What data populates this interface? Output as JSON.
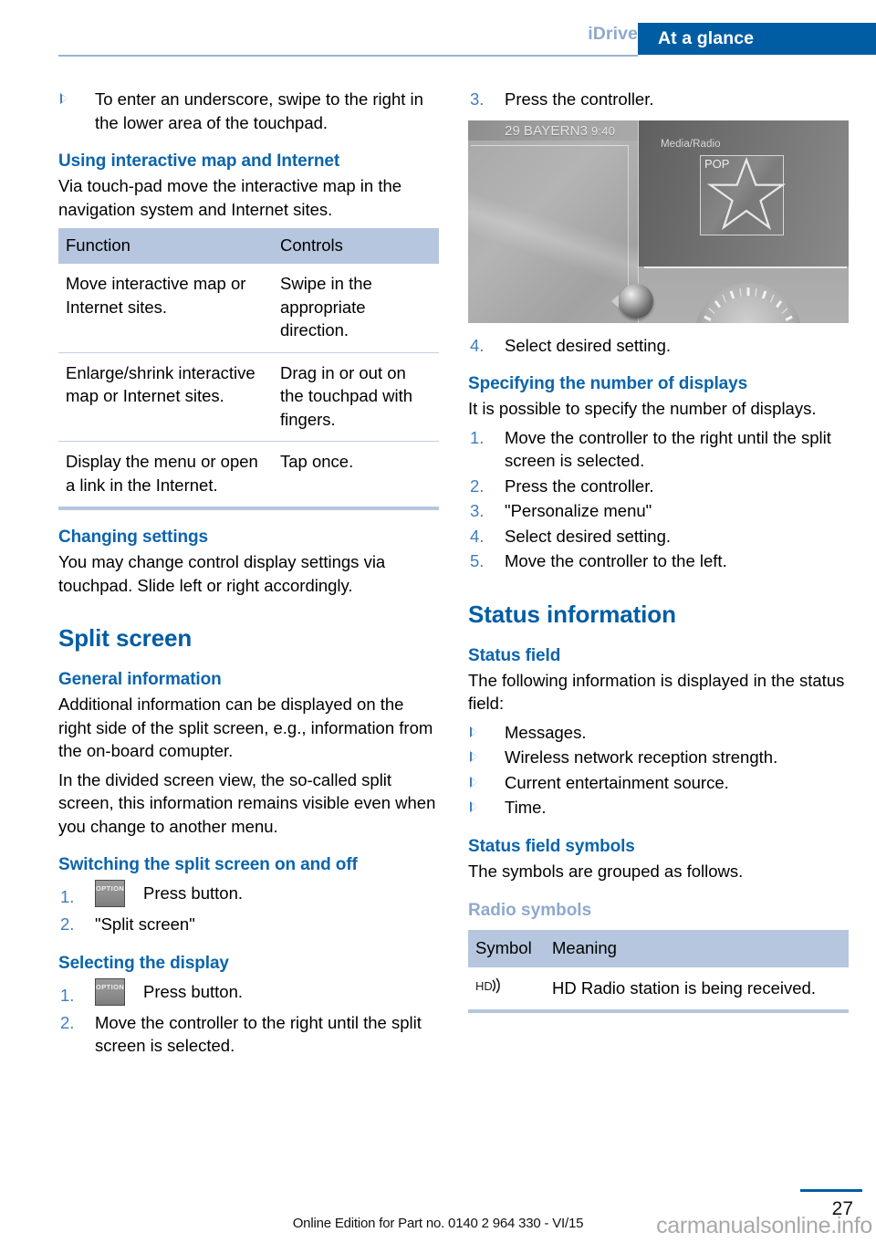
{
  "header": {
    "tab_secondary": "iDrive",
    "tab_active": "At a glance",
    "accent_blue": "#005da3",
    "muted_blue": "#8fa9cf"
  },
  "left_column": {
    "intro_bullet": "To enter an underscore, swipe to the right in the lower area of the touchpad.",
    "section_using_map": {
      "heading": "Using interactive map and Internet",
      "body": "Via touch-pad move the interactive map in the navigation system and Internet sites.",
      "table": {
        "columns": [
          "Function",
          "Controls"
        ],
        "rows": [
          [
            "Move interactive map or Internet sites.",
            "Swipe in the appropriate direction."
          ],
          [
            "Enlarge/shrink interactive map or Internet sites.",
            "Drag in or out on the touchpad with fingers."
          ],
          [
            "Display the menu or open a link in the Internet.",
            "Tap once."
          ]
        ]
      }
    },
    "section_changing_settings": {
      "heading": "Changing settings",
      "body": "You may change control display settings via touchpad. Slide left or right accordingly."
    },
    "section_split_screen": {
      "heading": "Split screen",
      "general": {
        "heading": "General information",
        "paragraph_1": "Additional information can be displayed on the right side of the split screen, e.g., information from the on-board comupter.",
        "paragraph_2": "In the divided screen view, the so-called split screen, this information remains visible even when you change to another menu."
      },
      "switching": {
        "heading": "Switching the split screen on and off",
        "steps": [
          {
            "num": "1.",
            "button": "OPTION",
            "text": "Press button."
          },
          {
            "num": "2.",
            "button": null,
            "text": "\"Split screen\""
          }
        ]
      },
      "selecting": {
        "heading": "Selecting the display",
        "steps": [
          {
            "num": "1.",
            "button": "OPTION",
            "text": "Press button."
          },
          {
            "num": "2.",
            "button": null,
            "text": "Move the controller to the right until the split screen is selected."
          }
        ]
      }
    }
  },
  "right_column": {
    "step_3": {
      "num": "3.",
      "text": "Press the controller."
    },
    "figure": {
      "station_number": "29",
      "station_name": "BAYERN3",
      "time": "9:40",
      "media_label": "Media/Radio",
      "genre_label": "POP"
    },
    "step_4": {
      "num": "4.",
      "text": "Select desired setting."
    },
    "section_specifying": {
      "heading": "Specifying the number of displays",
      "body": "It is possible to specify the number of displays.",
      "steps": [
        {
          "num": "1.",
          "text": "Move the controller to the right until the split screen is selected."
        },
        {
          "num": "2.",
          "text": "Press the controller."
        },
        {
          "num": "3.",
          "text": "\"Personalize menu\""
        },
        {
          "num": "4.",
          "text": "Select desired setting."
        },
        {
          "num": "5.",
          "text": "Move the controller to the left."
        }
      ]
    },
    "section_status": {
      "heading": "Status information",
      "status_field": {
        "heading": "Status field",
        "body": "The following information is displayed in the status field:",
        "bullets": [
          "Messages.",
          "Wireless network reception strength.",
          "Current entertainment source.",
          "Time."
        ]
      },
      "status_symbols": {
        "heading": "Status field symbols",
        "body": "The symbols are grouped as follows.",
        "group_heading": "Radio symbols",
        "table": {
          "columns": [
            "Symbol",
            "Meaning"
          ],
          "rows": [
            {
              "symbol_name": "hd-radio-icon",
              "meaning": "HD Radio station is being received."
            }
          ]
        }
      }
    }
  },
  "footer": {
    "edition_text": "Online Edition for Part no. 0140 2 964 330 - VI/15",
    "watermark": "carmanualsonline.info",
    "page_number": "27"
  }
}
